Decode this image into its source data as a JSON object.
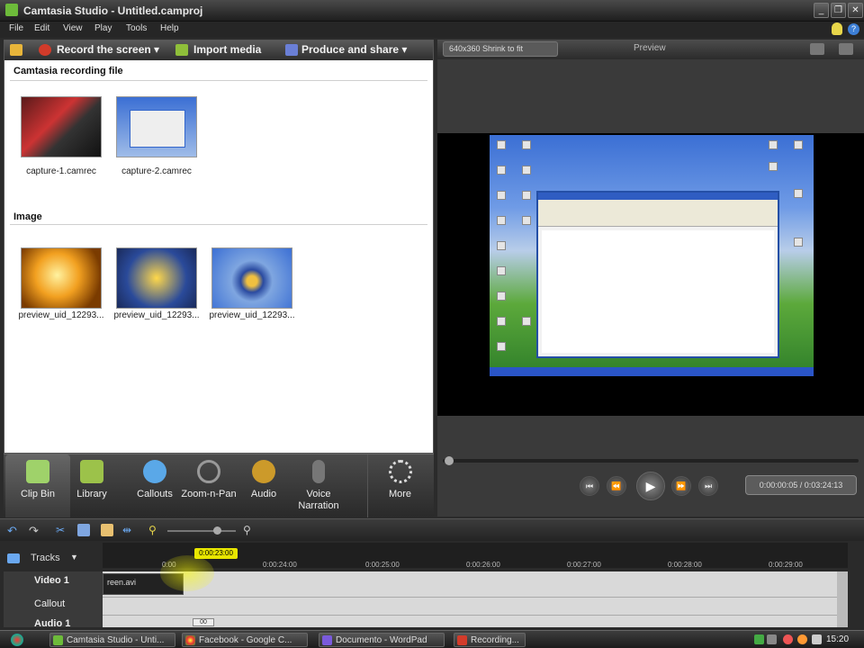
{
  "window": {
    "title": "Camtasia Studio - Untitled.camproj",
    "controls": [
      "_",
      "❐",
      "✕"
    ]
  },
  "menu": [
    "File",
    "Edit",
    "View",
    "Play",
    "Tools",
    "Help"
  ],
  "toolbar": {
    "record": "Record the screen ▾",
    "import": "Import media",
    "produce": "Produce and share ▾"
  },
  "clip_bin": {
    "recording_section": "Camtasia recording file",
    "recordings": [
      "capture-1.camrec",
      "capture-2.camrec"
    ],
    "image_section": "Image",
    "images": [
      "preview_uid_12293...",
      "preview_uid_12293...",
      "preview_uid_12293..."
    ]
  },
  "preview": {
    "size_option": "640x360 Shrink to fit",
    "title": "Preview",
    "time": "0:00:00:05 / 0:03:24:13"
  },
  "tool_tabs": [
    "Clip Bin",
    "Library",
    "Callouts",
    "Zoom-n-Pan",
    "Audio",
    "Voice Narration",
    "More"
  ],
  "timeline": {
    "tracks_label": "Tracks",
    "playhead": "0:00:23:00",
    "ticks": [
      "0:00",
      "0:00:24:00",
      "0:00:25:00",
      "0:00:26:00",
      "0:00:27:00",
      "0:00:28:00",
      "0:00:29:00"
    ],
    "track_names": [
      "Video 1",
      "Callout",
      "Audio 1"
    ],
    "clip_label": "reen.avi",
    "zoom_badge": "00"
  },
  "taskbar": {
    "tasks": [
      "Camtasia Studio - Unti...",
      "Facebook - Google C...",
      "Documento - WordPad",
      "Recording..."
    ],
    "clock": "15:20"
  },
  "colors": {
    "accent": "#6dbb3a",
    "playhead": "#e8e600"
  }
}
